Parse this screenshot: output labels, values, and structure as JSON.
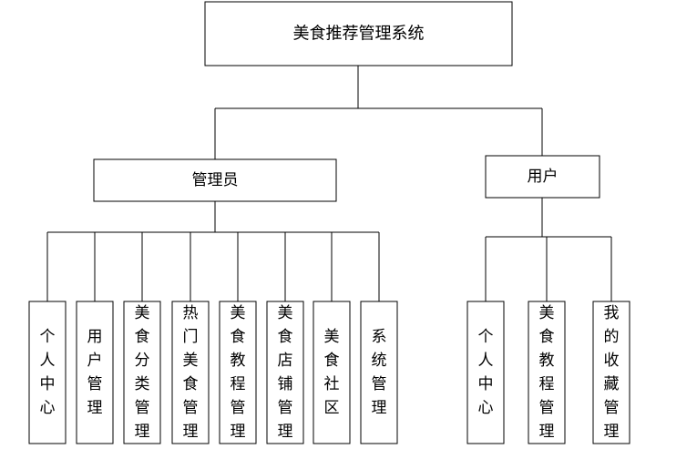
{
  "root": {
    "label": "美食推荐管理系统"
  },
  "branches": [
    {
      "id": "admin",
      "label": "管理员",
      "children": [
        "个人中心",
        "用户管理",
        "美食分类管理",
        "热门美食管理",
        "美食教程管理",
        "美食店铺管理",
        "美食社区",
        "系统管理"
      ]
    },
    {
      "id": "user",
      "label": "用户",
      "children": [
        "个人中心",
        "美食教程管理",
        "我的收藏管理"
      ]
    }
  ]
}
